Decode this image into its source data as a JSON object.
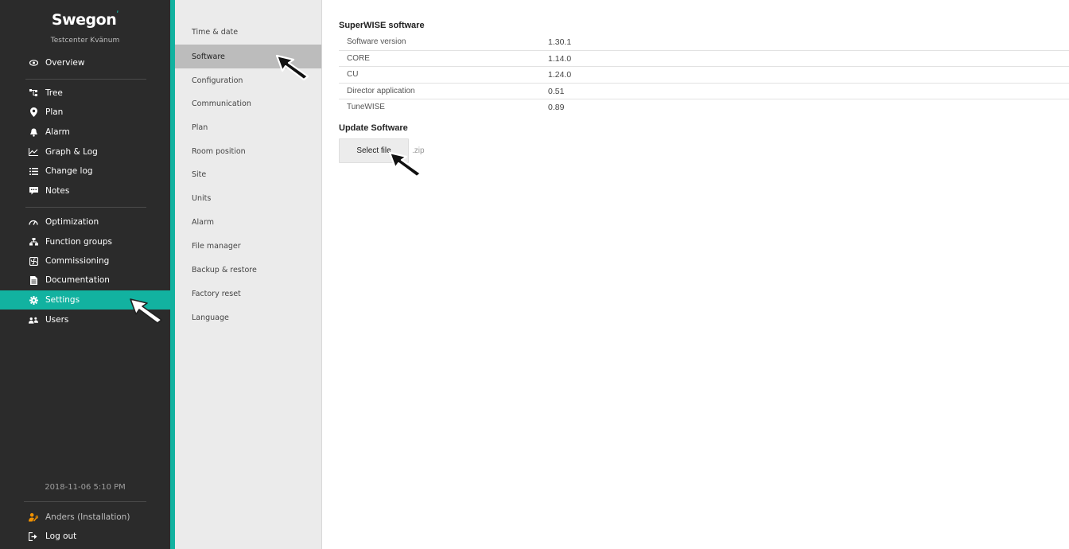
{
  "brand": {
    "logo_text": "Swegon",
    "site_name": "Testcenter Kvänum"
  },
  "sidebar": {
    "items": [
      {
        "id": "overview",
        "label": "Overview",
        "icon": "eye-icon"
      },
      {
        "id": "tree",
        "label": "Tree",
        "icon": "tree-icon"
      },
      {
        "id": "plan",
        "label": "Plan",
        "icon": "map-pin-icon"
      },
      {
        "id": "alarm",
        "label": "Alarm",
        "icon": "bell-icon"
      },
      {
        "id": "graph-log",
        "label": "Graph & Log",
        "icon": "chart-line-icon"
      },
      {
        "id": "change-log",
        "label": "Change log",
        "icon": "list-icon"
      },
      {
        "id": "notes",
        "label": "Notes",
        "icon": "comment-icon"
      },
      {
        "id": "optimization",
        "label": "Optimization",
        "icon": "gauge-icon"
      },
      {
        "id": "function-groups",
        "label": "Function groups",
        "icon": "hierarchy-icon"
      },
      {
        "id": "commissioning",
        "label": "Commissioning",
        "icon": "fan-icon"
      },
      {
        "id": "documentation",
        "label": "Documentation",
        "icon": "document-icon"
      },
      {
        "id": "settings",
        "label": "Settings",
        "icon": "gear-icon",
        "active": true
      },
      {
        "id": "users",
        "label": "Users",
        "icon": "users-icon"
      }
    ],
    "timestamp": "2018-11-06 5:10 PM",
    "user": {
      "label": "Anders (Installation)",
      "icon": "user-wrench-icon",
      "icon_color": "#f29200"
    },
    "logout": {
      "label": "Log out",
      "icon": "logout-icon"
    }
  },
  "submenu": {
    "items": [
      {
        "label": "Time & date"
      },
      {
        "label": "Software",
        "active": true
      },
      {
        "label": "Configuration"
      },
      {
        "label": "Communication"
      },
      {
        "label": "Plan"
      },
      {
        "label": "Room position"
      },
      {
        "label": "Site"
      },
      {
        "label": "Units"
      },
      {
        "label": "Alarm"
      },
      {
        "label": "File manager"
      },
      {
        "label": "Backup & restore"
      },
      {
        "label": "Factory reset"
      },
      {
        "label": "Language"
      }
    ]
  },
  "main": {
    "software_title": "SuperWISE software",
    "software_rows": [
      {
        "key": "Software version",
        "value": "1.30.1"
      },
      {
        "key": "CORE",
        "value": "1.14.0"
      },
      {
        "key": "CU",
        "value": "1.24.0"
      },
      {
        "key": "Director application",
        "value": "0.51"
      },
      {
        "key": "TuneWISE",
        "value": "0.89"
      }
    ],
    "update_title": "Update Software",
    "select_file_label": "Select file",
    "file_hint": ".zip"
  },
  "colors": {
    "accent": "#12b2a0",
    "sidebar_bg": "#2b2b2b",
    "submenu_bg": "#ebebeb",
    "submenu_active": "#bcbcbc",
    "user_icon": "#f29200"
  }
}
